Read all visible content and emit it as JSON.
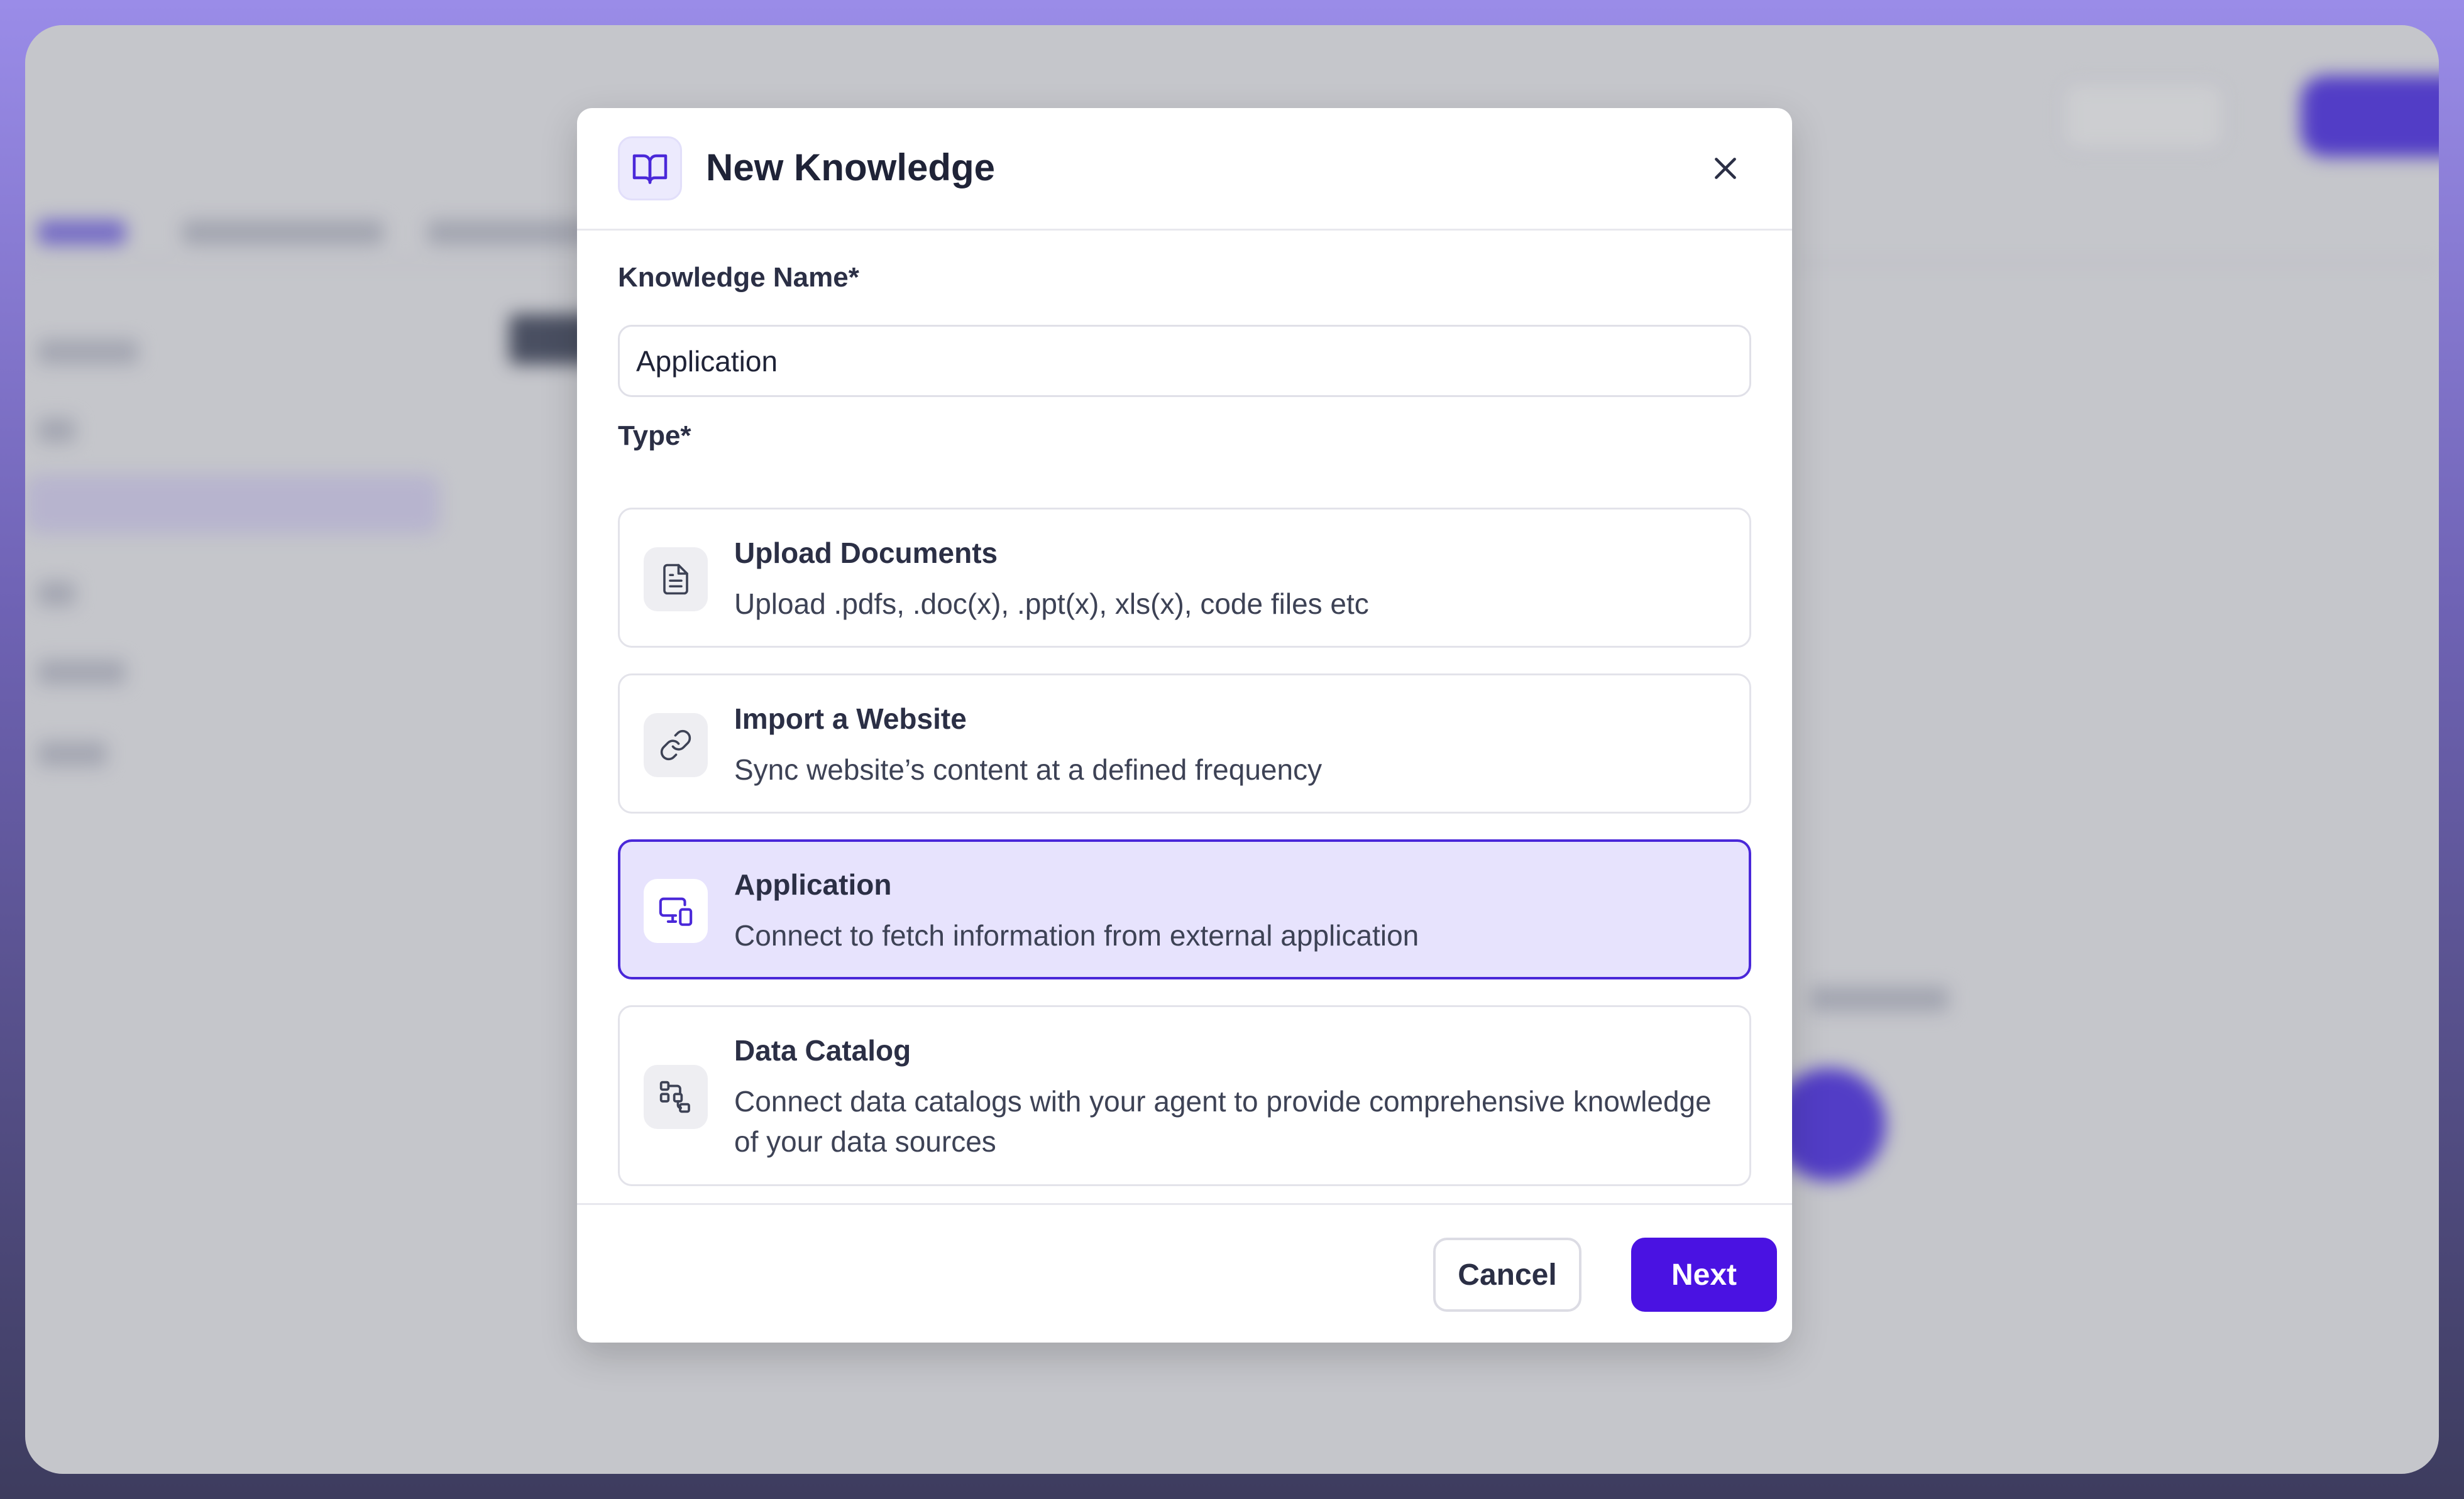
{
  "modal": {
    "title": "New Knowledge",
    "name_label": "Knowledge Name*",
    "name_value": "Application",
    "type_label": "Type*",
    "options": [
      {
        "title": "Upload Documents",
        "description": "Upload .pdfs, .doc(x), .ppt(x), xls(x), code files etc",
        "icon": "file-text-icon",
        "selected": false
      },
      {
        "title": "Import a Website",
        "description": "Sync website’s content at a defined frequency",
        "icon": "link-icon",
        "selected": false
      },
      {
        "title": "Application",
        "description": "Connect to fetch information from external application",
        "icon": "devices-icon",
        "selected": true
      },
      {
        "title": "Data Catalog",
        "description": "Connect data catalogs with your agent to provide comprehensive knowledge of your data sources",
        "icon": "data-catalog-icon",
        "selected": false
      }
    ],
    "cancel_label": "Cancel",
    "next_label": "Next"
  },
  "colors": {
    "accent": "#4a12e2",
    "selected_bg": "#e7e3fd",
    "selected_border": "#4a28d9"
  }
}
